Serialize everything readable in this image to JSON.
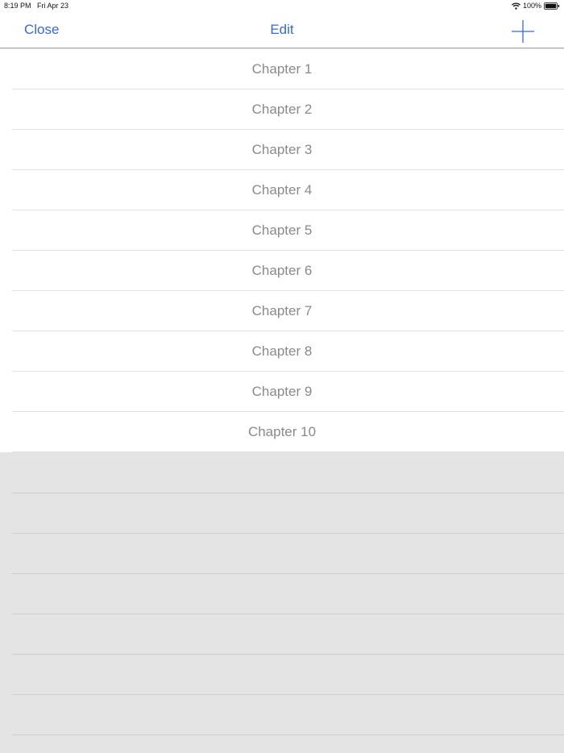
{
  "status_bar": {
    "time": "8:19 PM",
    "date": "Fri Apr 23",
    "battery": "100%"
  },
  "nav": {
    "close_label": "Close",
    "title": "Edit",
    "add_icon": "plus-icon"
  },
  "chapters": [
    {
      "label": "Chapter 1"
    },
    {
      "label": "Chapter 2"
    },
    {
      "label": "Chapter 3"
    },
    {
      "label": "Chapter 4"
    },
    {
      "label": "Chapter 5"
    },
    {
      "label": "Chapter 6"
    },
    {
      "label": "Chapter 7"
    },
    {
      "label": "Chapter 8"
    },
    {
      "label": "Chapter 9"
    },
    {
      "label": "Chapter 10"
    }
  ],
  "colors": {
    "accent": "#3a67d6",
    "chapter_text": "#8a8a8a",
    "empty_background": "#e4e4e4"
  }
}
